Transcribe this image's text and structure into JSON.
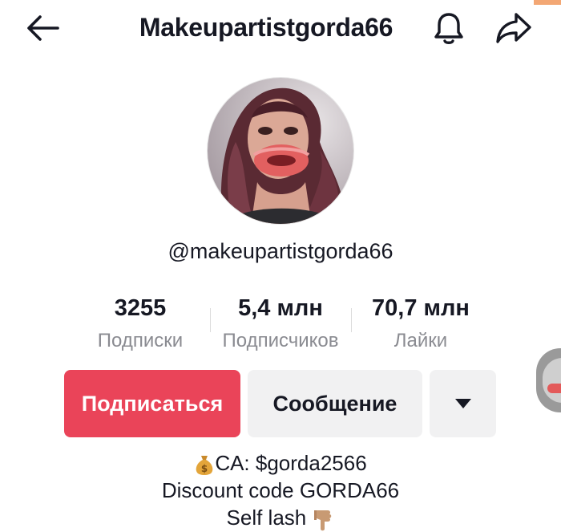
{
  "header": {
    "title": "Makeupartistgorda66",
    "back_icon": "arrow-left-icon",
    "bell_icon": "bell-icon",
    "share_icon": "share-arrow-icon"
  },
  "profile": {
    "handle": "@makeupartistgorda66"
  },
  "stats": [
    {
      "value": "3255",
      "label": "Подписки"
    },
    {
      "value": "5,4 млн",
      "label": "Подписчиков"
    },
    {
      "value": "70,7 млн",
      "label": "Лайки"
    }
  ],
  "actions": {
    "follow_label": "Подписаться",
    "message_label": "Сообщение",
    "more_icon": "caret-down-icon"
  },
  "bio": {
    "line1": "CA: $gorda2566",
    "line2": "Discount code GORDA66",
    "line3": "Self lash"
  },
  "colors": {
    "follow_button": "#ea4459",
    "secondary_button": "#f1f1f2",
    "label_gray": "#8a8b91",
    "text": "#161823"
  }
}
